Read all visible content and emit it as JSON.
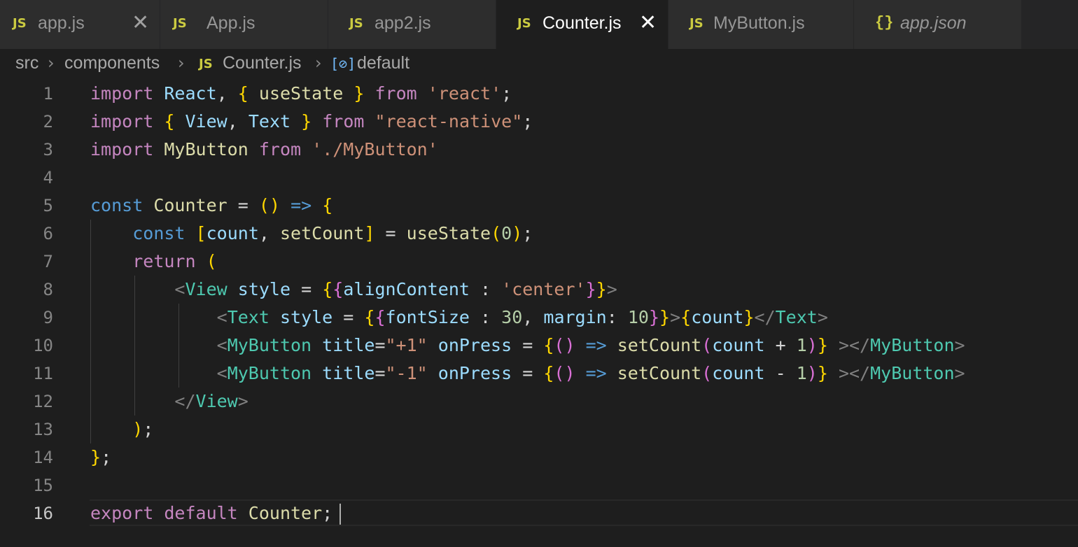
{
  "tabs": [
    {
      "label": "app.js",
      "icon": "JS",
      "active": false,
      "close": "✕"
    },
    {
      "label": "App.js",
      "icon": "JS",
      "active": false
    },
    {
      "label": "app2.js",
      "icon": "JS",
      "active": false
    },
    {
      "label": "Counter.js",
      "icon": "JS",
      "active": true,
      "close": "✕"
    },
    {
      "label": "MyButton.js",
      "icon": "JS",
      "active": false
    },
    {
      "label": "app.json",
      "icon": "{}",
      "active": false
    }
  ],
  "breadcrumb": {
    "items": [
      "src",
      "components",
      "Counter.js",
      "default"
    ],
    "separator": "›",
    "file_icon": "JS",
    "symbol_icon": "[⊘]"
  },
  "editor": {
    "current_line": 16,
    "line_numbers": [
      "1",
      "2",
      "3",
      "4",
      "5",
      "6",
      "7",
      "8",
      "9",
      "10",
      "11",
      "12",
      "13",
      "14",
      "15",
      "16"
    ],
    "lines": [
      "import React, { useState } from 'react';",
      "import { View, Text } from \"react-native\";",
      "import MyButton from './MyButton'",
      "",
      "const Counter = () => {",
      "    const [count, setCount] = useState(0);",
      "    return (",
      "        <View style = {{alignContent : 'center'}}>",
      "            <Text style = {{fontSize : 30, margin: 10}}>{count}</Text>",
      "            <MyButton title=\"+1\" onPress = {() => setCount(count + 1)} ></MyButton>",
      "            <MyButton title=\"-1\" onPress = {() => setCount(count - 1)} ></MyButton>",
      "        </View>",
      "    );",
      "};",
      "",
      "export default Counter;"
    ]
  },
  "colors": {
    "background": "#1e1e1e",
    "tab_bar": "#252526",
    "js_icon": "#cbcb41",
    "keyword": "#c586c0",
    "storage": "#569cd6",
    "variable": "#9cdcfe",
    "string": "#ce9178",
    "number": "#b5cea8",
    "tag": "#4ec9b0"
  }
}
